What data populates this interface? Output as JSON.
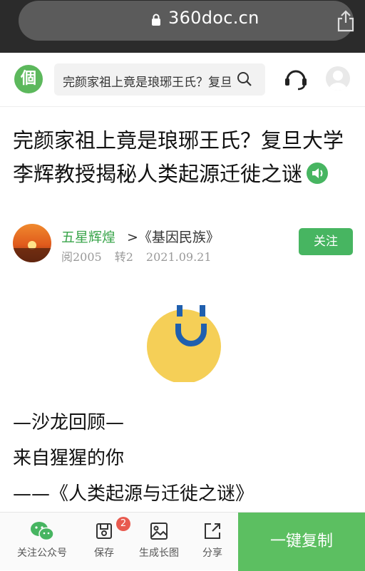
{
  "browser": {
    "url": "360doc.cn",
    "lock_icon": "lock-icon",
    "share_icon": "share-icon"
  },
  "header": {
    "logo_text": "個",
    "search_text": "完颜家祖上竟是琅琊王氏？复旦",
    "search_icon": "search-icon",
    "support_icon": "headset-icon",
    "avatar_icon": "user-avatar-icon"
  },
  "article": {
    "title": "完颜家祖上竟是琅琊王氏？复旦大学李辉教授揭秘人类起源迁徙之谜",
    "author": "五星辉煌",
    "category": ">《基因民族》",
    "reads": "阅2005",
    "reposts": "转2",
    "date": "2021.09.21",
    "follow_label": "关注",
    "paragraphs": [
      "—沙龙回顾—",
      "来自猩猩的你",
      "——《人类起源与迁徙之谜》"
    ]
  },
  "bottom_bar": {
    "wechat_label": "关注公众号",
    "save_label": "保存",
    "save_badge": "2",
    "long_image_label": "生成长图",
    "share_label": "分享",
    "copy_label": "一键复制"
  },
  "colors": {
    "accent_green": "#47b561",
    "copy_green": "#5cbf61",
    "badge_red": "#e85a4f",
    "emoji_yellow": "#f5cf57",
    "emoji_blue": "#1f5fae"
  }
}
